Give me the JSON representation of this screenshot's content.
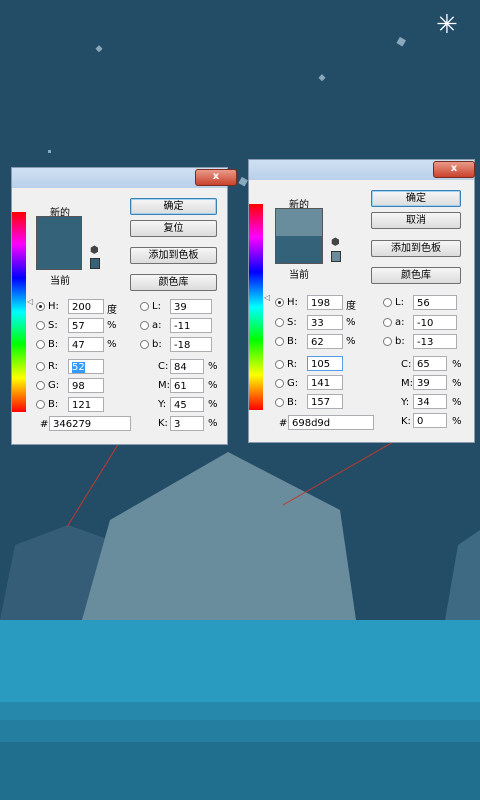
{
  "colors": {
    "sky": "#234c66",
    "left_mountain": "#355d77",
    "center_mountain": "#698d9d",
    "water_top": "#2a9bc0",
    "water_mid": "#2689ac",
    "water_bottom": "#206f8e",
    "annotation_line": "#c0392b"
  },
  "status": {
    "icon": "snowflake-icon",
    "glyph": "✳"
  },
  "left_dialog": {
    "close": "x",
    "new_label": "新的",
    "current_label": "当前",
    "new_color": "#346279",
    "current_color": "#346279",
    "buttons": {
      "ok": "确定",
      "reset": "复位",
      "add_to_swatches": "添加到色板",
      "color_library": "颜色库"
    },
    "hsb": {
      "h": "200",
      "h_unit": "度",
      "s": "57",
      "s_unit": "%",
      "b": "47",
      "b_unit": "%"
    },
    "lab": {
      "l": "39",
      "a": "-11",
      "b": "-18"
    },
    "rgb": {
      "r": "52",
      "g": "98",
      "b": "121"
    },
    "cmyk": {
      "c": "84",
      "m": "61",
      "y": "45",
      "k": "3",
      "unit": "%"
    },
    "hex": "346279",
    "labels": {
      "h": "H:",
      "s": "S:",
      "b": "B:",
      "l": "L:",
      "a": "a:",
      "lb": "b:",
      "r": "R:",
      "g": "G:",
      "bl": "B:",
      "c": "C:",
      "m": "M:",
      "y": "Y:",
      "k": "K:",
      "hash": "#"
    }
  },
  "right_dialog": {
    "close": "x",
    "new_label": "新的",
    "current_label": "当前",
    "new_color": "#698d9d",
    "current_color": "#346279",
    "buttons": {
      "ok": "确定",
      "cancel": "取消",
      "add_to_swatches": "添加到色板",
      "color_library": "颜色库"
    },
    "hsb": {
      "h": "198",
      "h_unit": "度",
      "s": "33",
      "s_unit": "%",
      "b": "62",
      "b_unit": "%"
    },
    "lab": {
      "l": "56",
      "a": "-10",
      "b": "-13"
    },
    "rgb": {
      "r": "105",
      "g": "141",
      "b": "157"
    },
    "cmyk": {
      "c": "65",
      "m": "39",
      "y": "34",
      "k": "0",
      "unit": "%"
    },
    "hex": "698d9d",
    "labels": {
      "h": "H:",
      "s": "S:",
      "b": "B:",
      "l": "L:",
      "a": "a:",
      "lb": "b:",
      "r": "R:",
      "g": "G:",
      "bl": "B:",
      "c": "C:",
      "m": "M:",
      "y": "Y:",
      "k": "K:",
      "hash": "#"
    }
  }
}
